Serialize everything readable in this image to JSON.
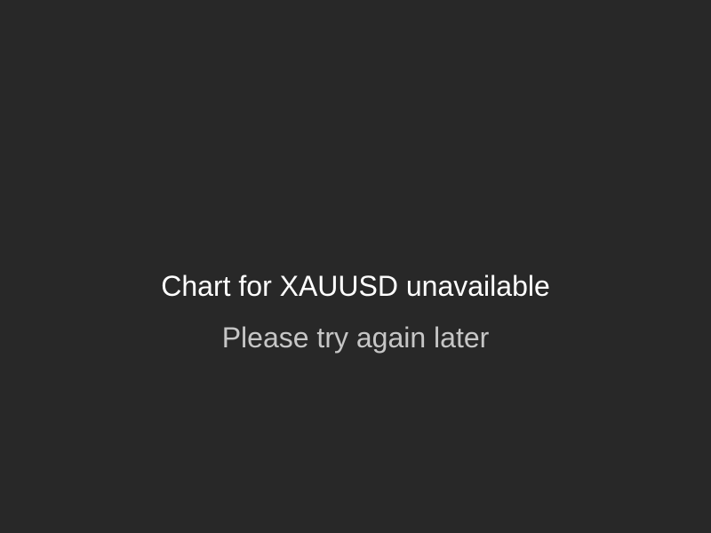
{
  "message": {
    "title": "Chart for XAUUSD unavailable",
    "subtitle": "Please try again later"
  },
  "colors": {
    "background": "#282828",
    "title_text": "#ffffff",
    "subtitle_text": "#c6c6c6"
  }
}
